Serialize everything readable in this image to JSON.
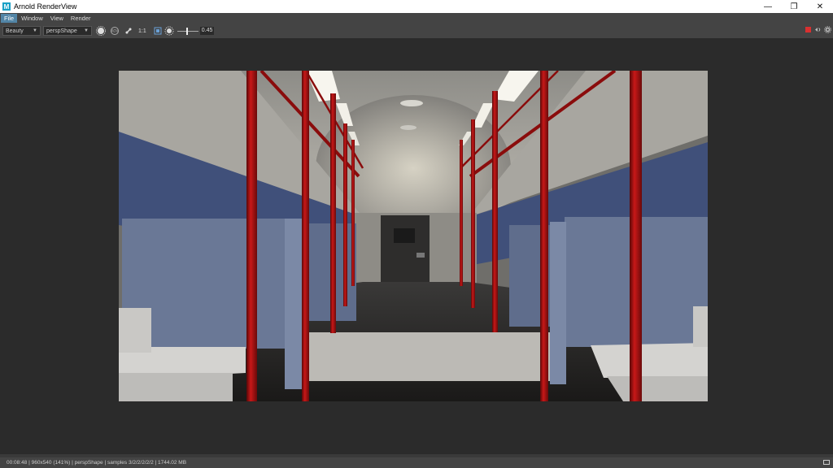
{
  "window": {
    "title": "Arnold RenderView",
    "logo_letter": "M"
  },
  "window_controls": {
    "minimize": "—",
    "maximize": "❐",
    "close": "✕"
  },
  "menu": [
    "File",
    "Window",
    "View",
    "Render"
  ],
  "toolbar": {
    "aov_value": "Beauty",
    "camera_value": "perspShape",
    "ratio_label": "1:1",
    "exposure_value": "0.45",
    "exposure_fraction": 0.45
  },
  "status": {
    "text": "00:08:48 | 960x540 (141%) | perspShape  | samples 3/2/2/2/2/2 | 1744.02 MB"
  },
  "colors": {
    "accent": "#5285a6",
    "stop": "#d93030",
    "pole": "#a01010",
    "seat_blue": "#6a7896"
  }
}
